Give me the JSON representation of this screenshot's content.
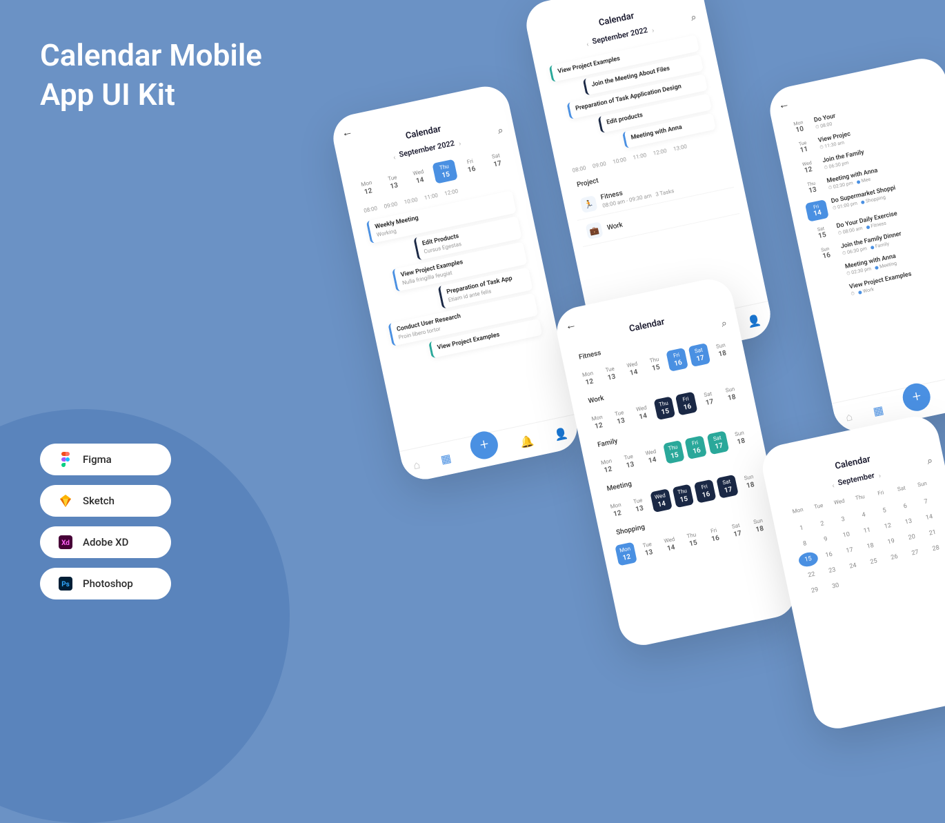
{
  "title_line1": "Calendar Mobile",
  "title_line2": "App UI Kit",
  "tools": {
    "figma": "Figma",
    "sketch": "Sketch",
    "xd": "Adobe XD",
    "ps": "Photoshop"
  },
  "header": "Calendar",
  "month": "September 2022",
  "month_short": "September",
  "days": [
    {
      "dn": "Mon",
      "dd": "12"
    },
    {
      "dn": "Tue",
      "dd": "13"
    },
    {
      "dn": "Wed",
      "dd": "14"
    },
    {
      "dn": "Thu",
      "dd": "15"
    },
    {
      "dn": "Fri",
      "dd": "16"
    },
    {
      "dn": "Sat",
      "dd": "17"
    },
    {
      "dn": "Sun",
      "dd": "18"
    }
  ],
  "times": [
    "08:00",
    "09:00",
    "10:00",
    "11:00",
    "12:00",
    "13:00"
  ],
  "ph1_events": [
    {
      "t": "Weekly Meeting",
      "s": "Working"
    },
    {
      "t": "Edit Products",
      "s": "Cursus Egestas"
    },
    {
      "t": "View Project Examples",
      "s": "Nulla fringilla feugiat"
    },
    {
      "t": "Preparation of Task App",
      "s": "Etiam id ante felis"
    },
    {
      "t": "Conduct User Research",
      "s": "Proin libero tortor"
    },
    {
      "t": "View Project Examples",
      "s": ""
    }
  ],
  "ph2_events": [
    {
      "t": "View Project Examples"
    },
    {
      "t": "Join the Meeting About Files"
    },
    {
      "t": "Preparation of Task Application Design"
    },
    {
      "t": "Edit products"
    },
    {
      "t": "Meeting with Anna"
    }
  ],
  "project_label": "Project",
  "projects": [
    {
      "name": "Fitness",
      "time": "08:00 am - 09:30 am",
      "tasks": "3 Tasks"
    },
    {
      "name": "Work",
      "time": "",
      "tasks": ""
    }
  ],
  "ph3_list": [
    {
      "dn": "Mon",
      "dd": "10",
      "t": "Do Your",
      "m": "08:00"
    },
    {
      "dn": "Tue",
      "dd": "11",
      "t": "View Projec",
      "m": "11:30 am"
    },
    {
      "dn": "Wed",
      "dd": "12",
      "t": "Join the Family",
      "m": "06:30 pm"
    },
    {
      "dn": "Thu",
      "dd": "13",
      "t": "Meeting with Anna",
      "m": "02:30 pm",
      "tag": "Mee"
    },
    {
      "dn": "Fri",
      "dd": "14",
      "t": "Do Supermarket Shoppi",
      "m": "01:00 pm",
      "tag": "Shopping",
      "active": true
    },
    {
      "dn": "Sat",
      "dd": "15",
      "t": "Do Your Daily Exercise",
      "m": "08:00 am",
      "tag": "Fitness"
    },
    {
      "dn": "Sun",
      "dd": "16",
      "t": "Join the Family Dinner",
      "m": "06:30 pm",
      "tag": "Family"
    },
    {
      "dn": "",
      "dd": "",
      "t": "Meeting with Anna",
      "m": "02:30 pm",
      "tag": "Meeting"
    },
    {
      "dn": "",
      "dd": "",
      "t": "View Project Examples",
      "m": "",
      "tag": "Work"
    }
  ],
  "ph4_cats": [
    "Fitness",
    "Work",
    "Family",
    "Meeting",
    "Shopping"
  ]
}
